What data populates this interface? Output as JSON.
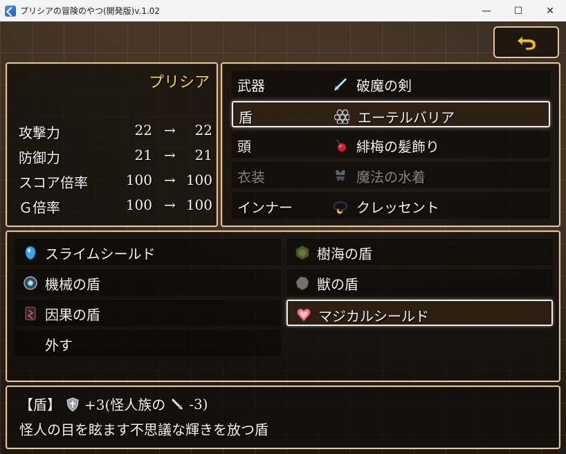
{
  "window": {
    "title": "プリシアの冒険のやつ(開発版)v.1.02",
    "minimize": "—",
    "maximize": "☐",
    "close": "✕"
  },
  "back_button": {
    "icon": "return-arrow-icon",
    "color": "#f2c230"
  },
  "character": {
    "name": "プリシア",
    "arrow": "→",
    "stats": [
      {
        "label": "攻撃力",
        "from": "22",
        "to": "22"
      },
      {
        "label": "防御力",
        "from": "21",
        "to": "21"
      },
      {
        "label": "スコア倍率",
        "from": "100",
        "to": "100"
      },
      {
        "label": "Ｇ倍率",
        "from": "100",
        "to": "100"
      }
    ]
  },
  "equipment": [
    {
      "slot": "武器",
      "item": "破魔の剣",
      "icon": "sword-icon",
      "selected": false,
      "disabled": false
    },
    {
      "slot": "盾",
      "item": "エーテルバリア",
      "icon": "hex-barrier-icon",
      "selected": true,
      "disabled": false
    },
    {
      "slot": "頭",
      "item": "緋梅の髪飾り",
      "icon": "hair-ornament-icon",
      "selected": false,
      "disabled": false
    },
    {
      "slot": "衣装",
      "item": "魔法の水着",
      "icon": "swimsuit-icon",
      "selected": false,
      "disabled": true
    },
    {
      "slot": "インナー",
      "item": "クレッセント",
      "icon": "crescent-icon",
      "selected": false,
      "disabled": false
    }
  ],
  "item_list": [
    {
      "label": "スライムシールド",
      "icon": "slime-shield-icon",
      "selected": false
    },
    {
      "label": "樹海の盾",
      "icon": "forest-shield-icon",
      "selected": false
    },
    {
      "label": "機械の盾",
      "icon": "machine-shield-icon",
      "selected": false
    },
    {
      "label": "獣の盾",
      "icon": "beast-shield-icon",
      "selected": false
    },
    {
      "label": "因果の盾",
      "icon": "causality-shield-icon",
      "selected": false
    },
    {
      "label": "マジカルシールド",
      "icon": "heart-shield-icon",
      "selected": true
    },
    {
      "label": "外す",
      "icon": "",
      "selected": false
    }
  ],
  "help": {
    "bracket_label": "【盾】",
    "effect_prefix": "+3(怪人族の",
    "effect_suffix": "-3)",
    "description": "怪人の目を眩ます不思議な輝きを放つ盾",
    "icons": [
      "shield-icon",
      "sword-icon"
    ]
  }
}
